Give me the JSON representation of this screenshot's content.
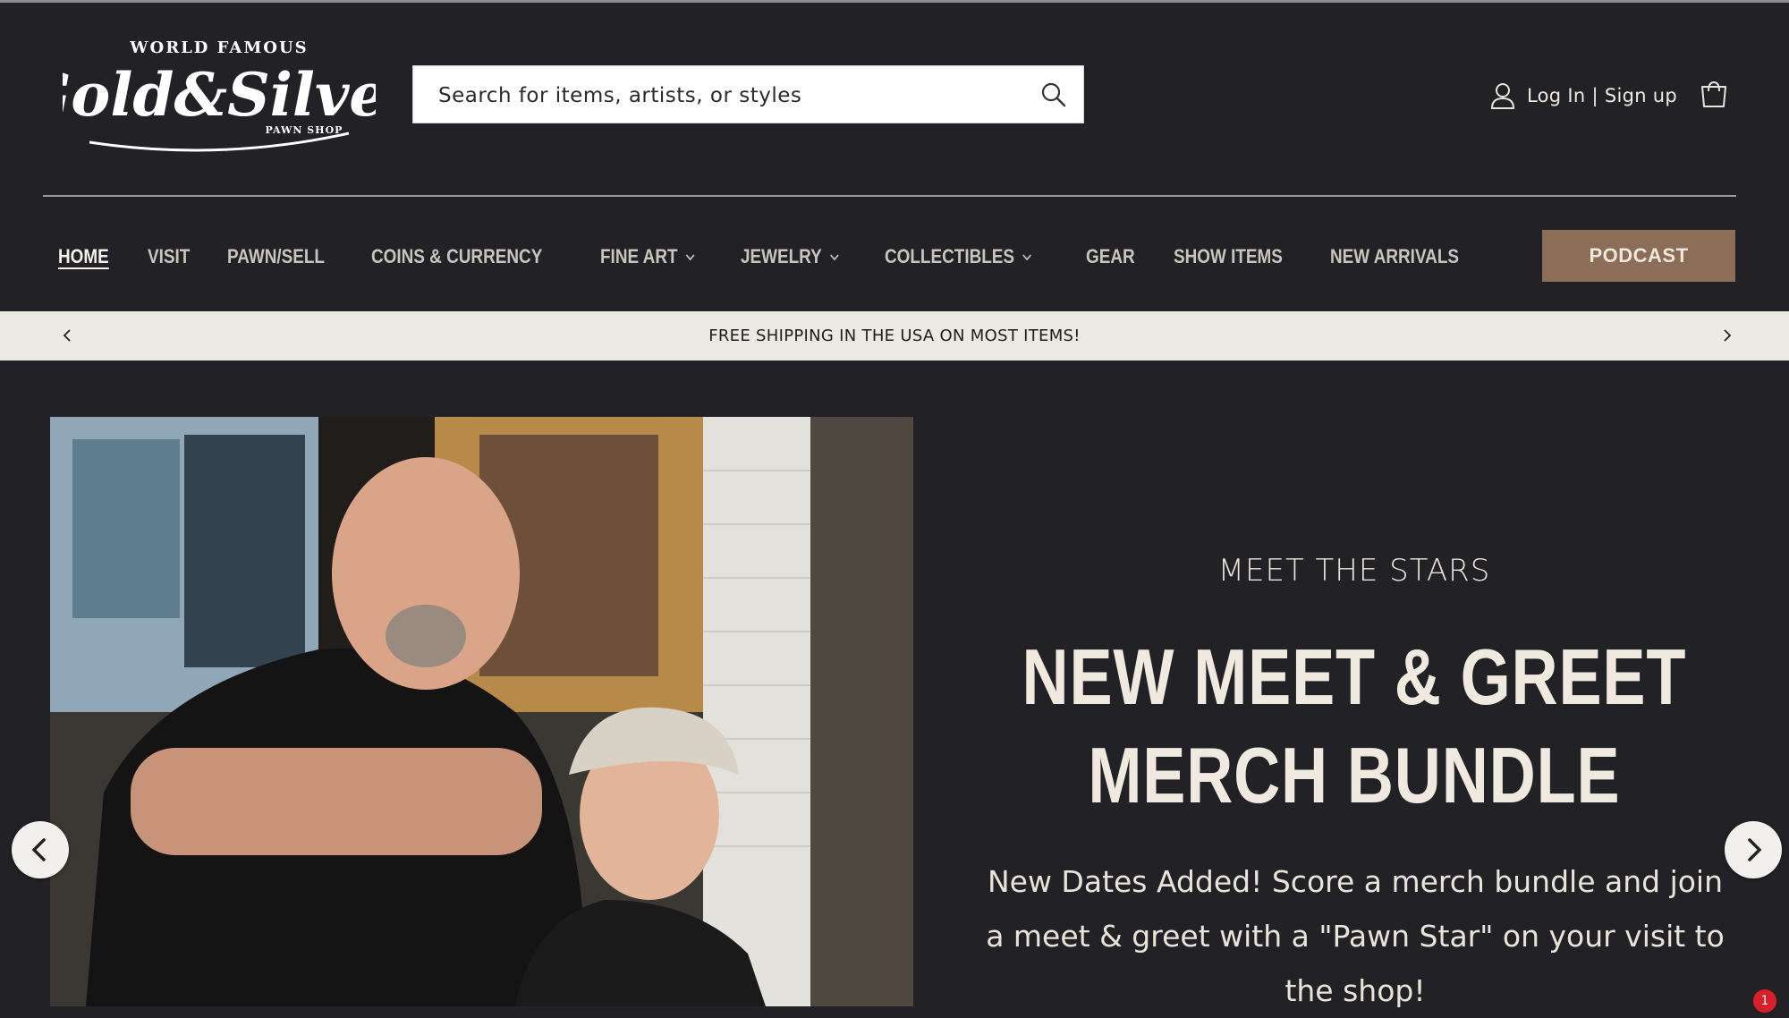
{
  "header": {
    "logo": {
      "top": "WORLD FAMOUS",
      "main": "Gold&Silver",
      "sub": "PAWN SHOP"
    },
    "search": {
      "placeholder": "Search for items, artists, or styles"
    },
    "account_label": "Log In | Sign up"
  },
  "nav": {
    "items": [
      {
        "label": "HOME",
        "active": true
      },
      {
        "label": "VISIT"
      },
      {
        "label": "PAWN/SELL"
      },
      {
        "label": "COINS & CURRENCY"
      },
      {
        "label": "FINE ART",
        "dropdown": true
      },
      {
        "label": "JEWELRY",
        "dropdown": true
      },
      {
        "label": "COLLECTIBLES",
        "dropdown": true
      },
      {
        "label": "GEAR"
      },
      {
        "label": "SHOW ITEMS"
      },
      {
        "label": "NEW ARRIVALS"
      }
    ],
    "podcast_label": "PODCAST"
  },
  "announcement": {
    "text": "FREE SHIPPING IN THE USA ON MOST ITEMS!"
  },
  "hero": {
    "eyebrow": "MEET THE STARS",
    "headline_line1": "NEW MEET & GREET",
    "headline_line2": "MERCH BUNDLE",
    "description": "New Dates Added! Score a merch bundle and join a meet & greet with a \"Pawn Star\" on your visit to the shop!"
  },
  "chat_badge": "1",
  "colors": {
    "background": "#222126",
    "accent": "#8c6d57",
    "announcement_bg": "#ece9e2"
  }
}
